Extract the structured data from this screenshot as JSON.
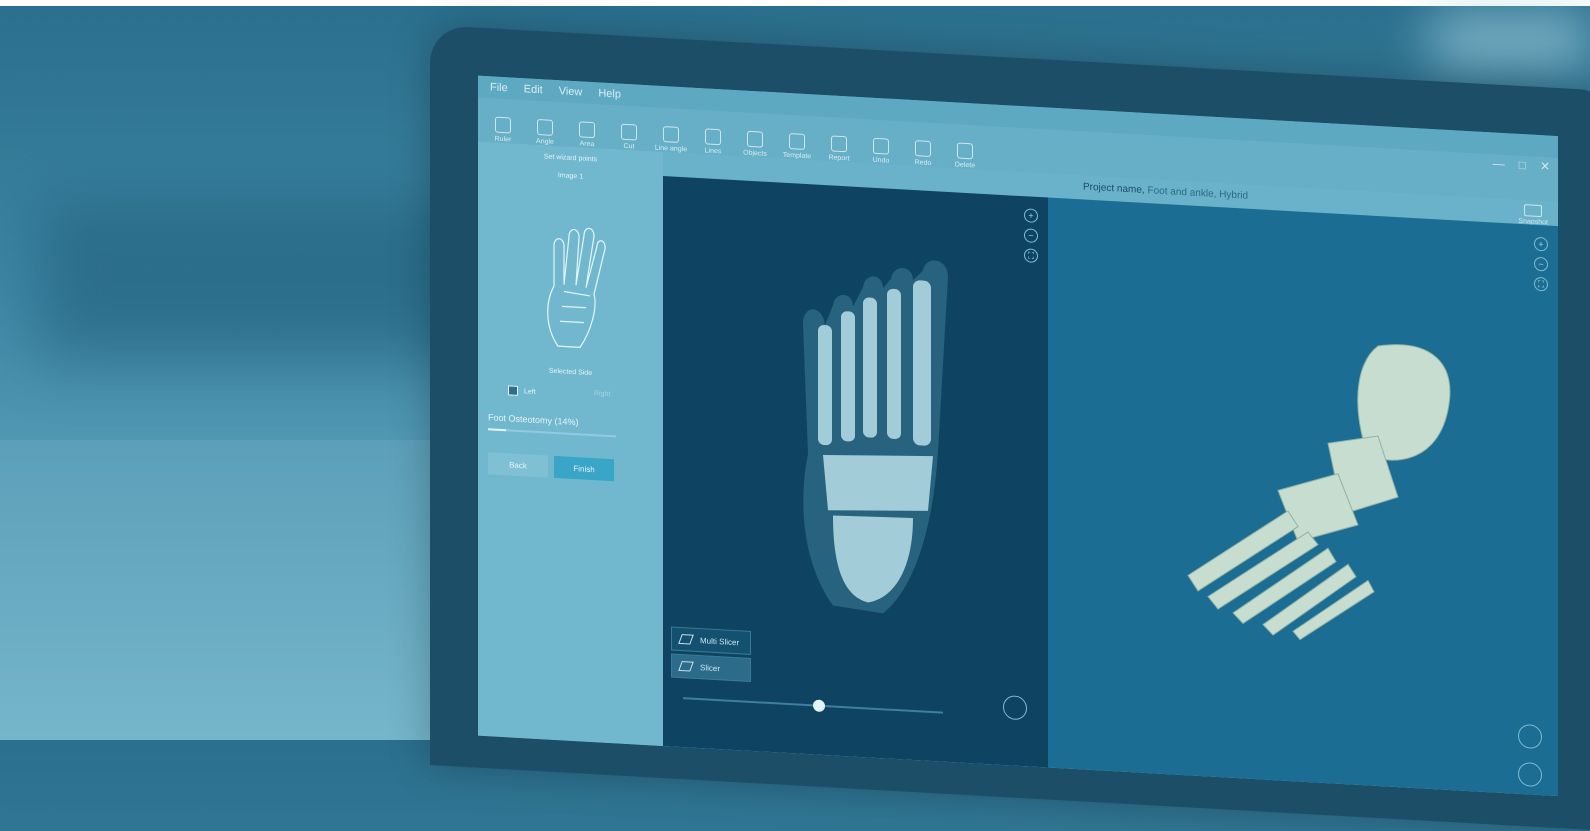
{
  "menu": [
    "File",
    "Edit",
    "View",
    "Help"
  ],
  "toolbar": [
    {
      "label": "Ruler",
      "icon": "ruler-icon"
    },
    {
      "label": "Angle",
      "icon": "angle-icon"
    },
    {
      "label": "Area",
      "icon": "area-icon"
    },
    {
      "label": "Cut",
      "icon": "scissors-icon"
    },
    {
      "label": "Line angle",
      "icon": "line-angle-icon"
    },
    {
      "label": "Lines",
      "icon": "lines-icon"
    },
    {
      "label": "Objects",
      "icon": "objects-icon"
    },
    {
      "label": "Template",
      "icon": "template-icon"
    },
    {
      "label": "Report",
      "icon": "report-icon"
    },
    {
      "label": "Undo",
      "icon": "undo-icon"
    },
    {
      "label": "Redo",
      "icon": "redo-icon"
    },
    {
      "label": "Delete",
      "icon": "trash-icon"
    }
  ],
  "left_panel": {
    "title": "Set wizard points",
    "image_label": "Image 1",
    "selected_side_label": "Selected Side",
    "left_option": "Left",
    "right_option": "Right",
    "progress_label": "Foot Osteotomy (14%)",
    "progress": 0.14,
    "back_button": "Back",
    "finish_button": "Finish"
  },
  "project": {
    "label": "Project name,",
    "value": "Foot and ankle, Hybrid",
    "snapshot": "Snapshot"
  },
  "view_menu": {
    "items": [
      "Multi Slicer",
      "Slicer"
    ]
  },
  "colors": {
    "accent": "#3aa6c7",
    "dark_view": "#0e4462",
    "model_view": "#1b6d93"
  }
}
